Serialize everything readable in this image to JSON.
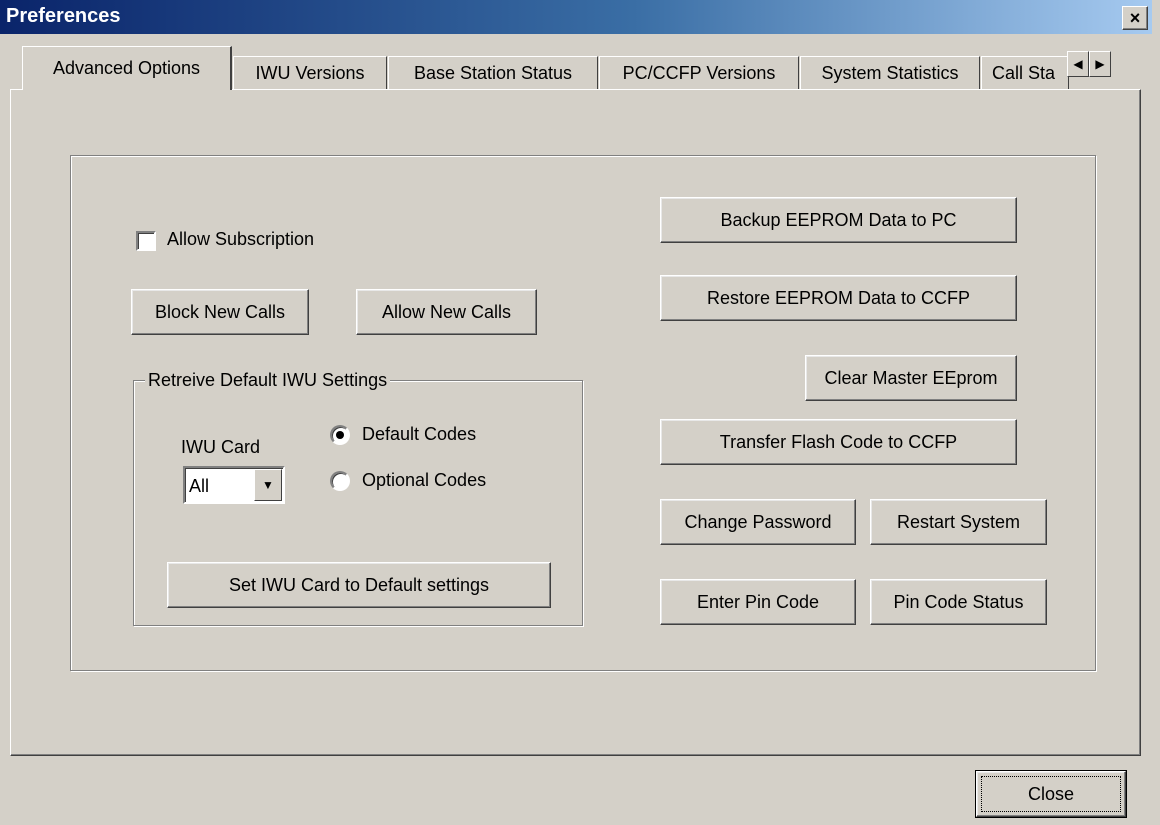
{
  "window": {
    "title": "Preferences",
    "close_glyph": "×"
  },
  "tabs": [
    {
      "label": "Advanced Options",
      "active": true
    },
    {
      "label": "IWU Versions"
    },
    {
      "label": "Base Station Status"
    },
    {
      "label": "PC/CCFP Versions"
    },
    {
      "label": "System Statistics"
    },
    {
      "label": "Call Sta"
    }
  ],
  "tab_scroll": {
    "left": "◀",
    "right": "▶"
  },
  "advanced": {
    "allow_subscription": {
      "label": "Allow Subscription",
      "checked": false
    },
    "block_new_calls": "Block New Calls",
    "allow_new_calls": "Allow New Calls",
    "retrieve_group": {
      "label": "Retreive Default IWU Settings",
      "iwu_card_label": "IWU Card",
      "iwu_card_value": "All",
      "dropdown_glyph": "▼",
      "default_codes": "Default Codes",
      "optional_codes": "Optional Codes",
      "selected": "default",
      "set_default_button": "Set IWU Card to Default settings"
    },
    "backup_eeprom": "Backup EEPROM Data to PC",
    "restore_eeprom": "Restore EEPROM Data to CCFP",
    "clear_master": "Clear Master EEprom",
    "transfer_flash": "Transfer Flash Code to CCFP",
    "change_password": "Change Password",
    "restart_system": "Restart System",
    "enter_pin": "Enter Pin Code",
    "pin_status": "Pin Code Status"
  },
  "footer": {
    "close": "Close"
  }
}
